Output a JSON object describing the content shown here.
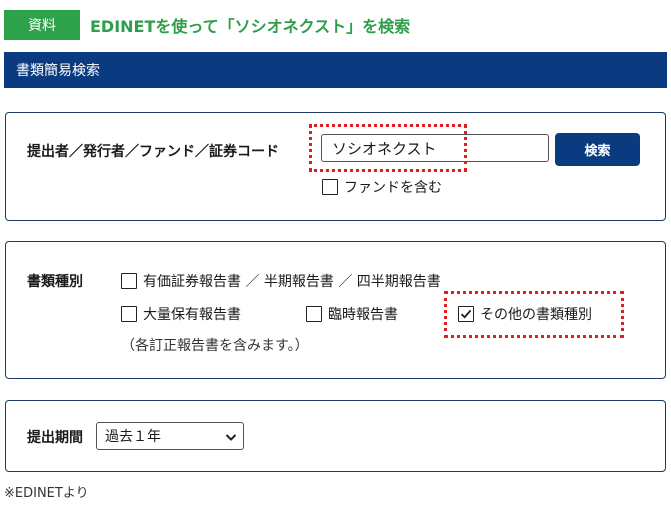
{
  "header": {
    "badge": "資料",
    "headline": "EDINETを使って「ソシオネクスト」を検索",
    "section_title": "書類簡易検索"
  },
  "search": {
    "label": "提出者／発行者／ファンド／証券コード",
    "value": "ソシオネクスト",
    "button": "検索",
    "include_fund": {
      "label": "ファンドを含む",
      "checked": false
    }
  },
  "doc_types": {
    "label": "書類種別",
    "options": [
      {
        "label": "有価証券報告書 ／ 半期報告書 ／ 四半期報告書",
        "checked": false
      },
      {
        "label": "大量保有報告書",
        "checked": false
      },
      {
        "label": "臨時報告書",
        "checked": false
      },
      {
        "label": "その他の書類種別",
        "checked": true
      }
    ],
    "note": "（各訂正報告書を含みます。）"
  },
  "period": {
    "label": "提出期間",
    "selected": "過去１年"
  },
  "footnote": "※EDINETより",
  "colors": {
    "navy": "#0a3a80",
    "green": "#2ea24a",
    "highlight": "#e01e1e"
  }
}
